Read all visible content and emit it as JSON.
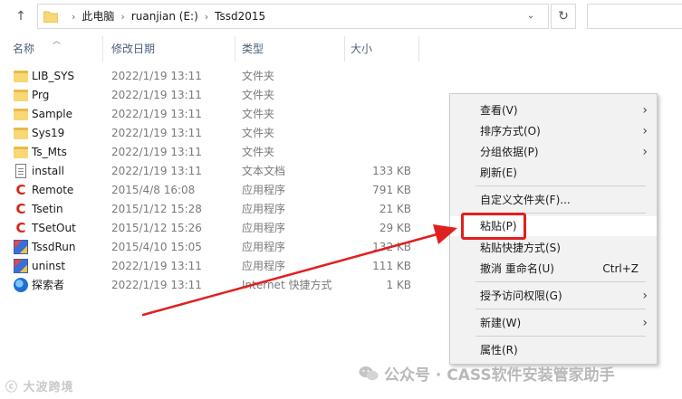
{
  "address": {
    "crumbs": [
      "此电脑",
      "ruanjian (E:)",
      "Tssd2015"
    ]
  },
  "columns": {
    "name": "名称",
    "modified": "修改日期",
    "type": "类型",
    "size": "大小"
  },
  "files": [
    {
      "name": "LIB_SYS",
      "date": "2022/1/19 13:11",
      "type": "文件夹",
      "size": "",
      "icon": "folder-icon"
    },
    {
      "name": "Prg",
      "date": "2022/1/19 13:11",
      "type": "文件夹",
      "size": "",
      "icon": "folder-icon"
    },
    {
      "name": "Sample",
      "date": "2022/1/19 13:11",
      "type": "文件夹",
      "size": "",
      "icon": "folder-icon"
    },
    {
      "name": "Sys19",
      "date": "2022/1/19 13:11",
      "type": "文件夹",
      "size": "",
      "icon": "folder-icon"
    },
    {
      "name": "Ts_Mts",
      "date": "2022/1/19 13:11",
      "type": "文件夹",
      "size": "",
      "icon": "folder-icon"
    },
    {
      "name": "install",
      "date": "2022/1/19 13:11",
      "type": "文本文档",
      "size": "133 KB",
      "icon": "text-file-icon"
    },
    {
      "name": "Remote",
      "date": "2015/4/8 16:08",
      "type": "应用程序",
      "size": "791 KB",
      "icon": "app-icon"
    },
    {
      "name": "Tsetin",
      "date": "2015/1/12 15:28",
      "type": "应用程序",
      "size": "21 KB",
      "icon": "app-icon"
    },
    {
      "name": "TSetOut",
      "date": "2015/1/12 15:26",
      "type": "应用程序",
      "size": "29 KB",
      "icon": "app-icon"
    },
    {
      "name": "TssdRun",
      "date": "2015/4/10 15:05",
      "type": "应用程序",
      "size": "132 KB",
      "icon": "grid-app-icon"
    },
    {
      "name": "uninst",
      "date": "2022/1/19 13:11",
      "type": "应用程序",
      "size": "111 KB",
      "icon": "grid-app-icon"
    },
    {
      "name": "探索者",
      "date": "2022/1/19 13:11",
      "type": "Internet 快捷方式",
      "size": "1 KB",
      "icon": "internet-shortcut-icon"
    }
  ],
  "context_menu": {
    "items": [
      {
        "label": "查看(V)",
        "submenu": true
      },
      {
        "label": "排序方式(O)",
        "submenu": true
      },
      {
        "label": "分组依据(P)",
        "submenu": true
      },
      {
        "label": "刷新(E)",
        "submenu": false
      },
      {
        "label": "自定义文件夹(F)...",
        "submenu": false
      },
      {
        "label": "粘贴(P)",
        "submenu": false,
        "highlighted": true
      },
      {
        "label": "粘贴快捷方式(S)",
        "submenu": false
      },
      {
        "label": "撤消 重命名(U)",
        "submenu": false,
        "shortcut": "Ctrl+Z"
      },
      {
        "label": "授予访问权限(G)",
        "submenu": true
      },
      {
        "label": "新建(W)",
        "submenu": true
      },
      {
        "label": "属性(R)",
        "submenu": false
      }
    ]
  },
  "watermarks": {
    "left": "大波跨境",
    "right": "公众号 · CASS软件安装管家助手"
  },
  "colors": {
    "annotation_red": "#e02020",
    "folder_yellow": "#f8d775",
    "menu_bg": "#f2f2f2"
  }
}
